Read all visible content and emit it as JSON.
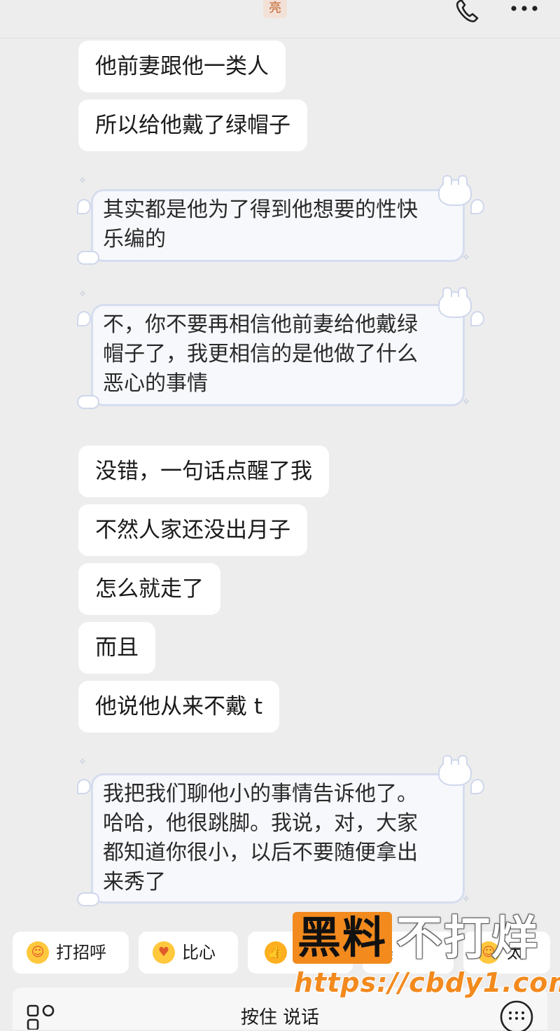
{
  "header": {
    "title_fragment": "亮",
    "call_icon": "phone-icon",
    "more_icon": "more-dots-icon"
  },
  "messages": [
    {
      "style": "plain",
      "text": "他前妻跟他一类人"
    },
    {
      "style": "plain",
      "text": "所以给他戴了绿帽子"
    },
    {
      "style": "decorated",
      "lines": [
        "其实都是他为了得到他想要的性快",
        "乐编的"
      ]
    },
    {
      "style": "decorated",
      "lines": [
        "不，你不要再相信他前妻给他戴绿",
        "帽子了，我更相信的是他做了什么",
        "恶心的事情"
      ]
    },
    {
      "style": "plain",
      "text": "没错，一句话点醒了我"
    },
    {
      "style": "plain",
      "text": "不然人家还没出月子"
    },
    {
      "style": "plain",
      "text": "怎么就走了"
    },
    {
      "style": "plain",
      "text": "而且"
    },
    {
      "style": "plain",
      "text": "他说他从来不戴 t"
    },
    {
      "style": "decorated",
      "lines": [
        "我把我们聊他小的事情告诉他了。",
        "哈哈，他很跳脚。我说，对，大家",
        "都知道你很小，以后不要随便拿出",
        "来秀了"
      ]
    }
  ],
  "quick_replies": [
    {
      "label": "打招呼",
      "icon": "wave-emoji-icon"
    },
    {
      "label": "比心",
      "icon": "heart-hands-emoji-icon"
    },
    {
      "label": "",
      "icon": "thumbs-up-emoji-icon"
    },
    {
      "label": "美",
      "icon": ""
    },
    {
      "label": "太",
      "icon": "emoji-icon"
    }
  ],
  "input_bar": {
    "press_to_talk": "按住 说话",
    "left_icon": "apps-grid-icon",
    "right_icon": "keyboard-icon"
  },
  "watermark": {
    "badge": "黑料",
    "text": "不打烊",
    "url": "https://cbdy1.com"
  },
  "colors": {
    "background": "#ededed",
    "bubble": "#ffffff",
    "decorated_border": "#d6ddef",
    "watermark_orange": "#f28a1e"
  }
}
